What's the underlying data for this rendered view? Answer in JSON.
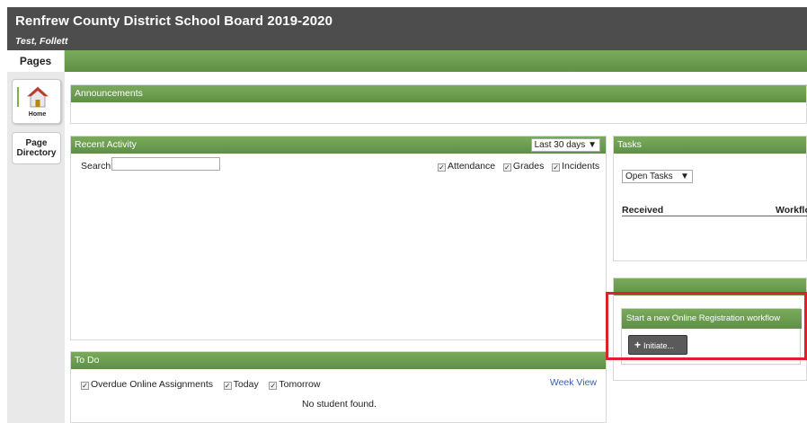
{
  "header": {
    "title": "Renfrew County District School Board 2019-2020",
    "user": "Test, Follett"
  },
  "sidebar": {
    "tab_label": "Pages",
    "items": [
      {
        "label": "Home",
        "icon": "home-icon"
      },
      {
        "label": "Page Directory"
      }
    ]
  },
  "announcements": {
    "title": "Announcements"
  },
  "recent_activity": {
    "title": "Recent Activity",
    "range_selected": "Last 30 days",
    "search_label": "Search:",
    "search_value": "",
    "filters": [
      {
        "label": "Attendance",
        "checked": true
      },
      {
        "label": "Grades",
        "checked": true
      },
      {
        "label": "Incidents",
        "checked": true
      }
    ]
  },
  "todo": {
    "title": "To Do",
    "filters": [
      {
        "label": "Overdue Online Assignments",
        "checked": true
      },
      {
        "label": "Today",
        "checked": true
      },
      {
        "label": "Tomorrow",
        "checked": true
      }
    ],
    "week_view_label": "Week View",
    "empty_message": "No student found."
  },
  "tasks": {
    "title": "Tasks",
    "filter_selected": "Open Tasks",
    "columns": [
      "Received",
      "Workflo"
    ]
  },
  "workflow": {
    "title": "Start a new Online Registration workflow",
    "initiate_label": "Initiate..."
  },
  "colors": {
    "header_bg": "#4d4d4d",
    "accent_green": "#6a9b4e",
    "highlight_red": "#e0202a",
    "link_blue": "#3a5fb0"
  }
}
